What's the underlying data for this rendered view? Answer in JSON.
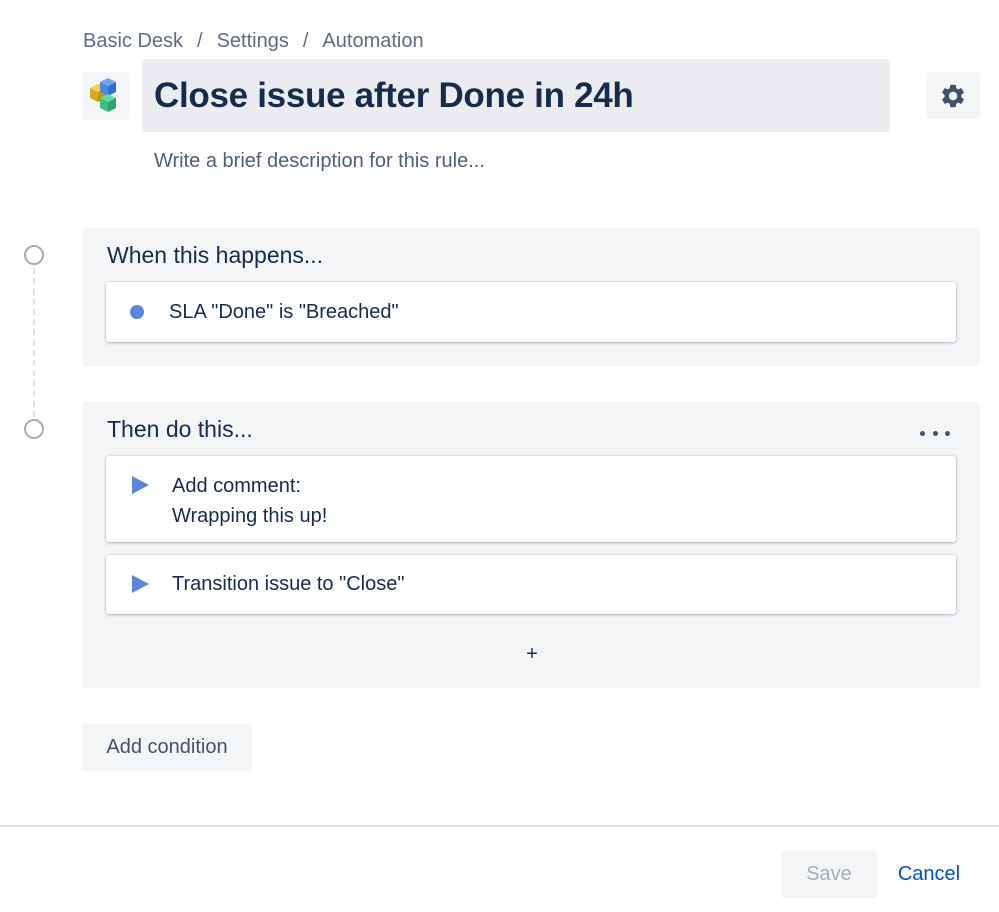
{
  "breadcrumb": {
    "items": [
      "Basic Desk",
      "Settings",
      "Automation"
    ],
    "separator": "/"
  },
  "app_icon": {
    "name": "automation-cubes-icon"
  },
  "rule": {
    "title": "Close issue after Done in 24h",
    "description_placeholder": "Write a brief description for this rule..."
  },
  "settings": {
    "icon": "gear-icon"
  },
  "trigger_block": {
    "title": "When this happens...",
    "trigger": {
      "icon": "dot-icon",
      "text": "SLA \"Done\" is \"Breached\""
    }
  },
  "action_block": {
    "title": "Then do this...",
    "more_icon": "more-horizontal-icon",
    "actions": [
      {
        "icon": "play-icon",
        "line1": "Add comment:",
        "line2": "Wrapping this up!"
      },
      {
        "icon": "play-icon",
        "line1": "Transition issue to \"Close\""
      }
    ],
    "add_label": "+"
  },
  "add_condition_label": "Add condition",
  "footer": {
    "save_label": "Save",
    "cancel_label": "Cancel"
  },
  "colors": {
    "accent": "#0052cc",
    "trigger_dot": "#5b86e0",
    "block_bg": "#f4f5f7",
    "title_bg": "#ebecf0"
  }
}
